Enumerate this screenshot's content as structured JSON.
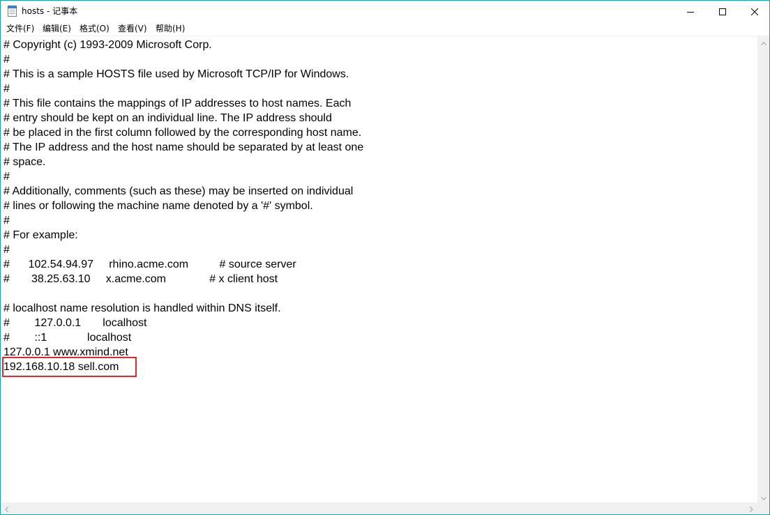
{
  "window": {
    "title": "hosts - 记事本",
    "app_icon": "notepad-icon",
    "controls": {
      "minimize": "minimize-icon",
      "maximize": "maximize-icon",
      "close": "close-icon"
    }
  },
  "menu": {
    "items": [
      {
        "label": "文件(F)"
      },
      {
        "label": "编辑(E)"
      },
      {
        "label": "格式(O)"
      },
      {
        "label": "查看(V)"
      },
      {
        "label": "帮助(H)"
      }
    ]
  },
  "document": {
    "lines": [
      "# Copyright (c) 1993-2009 Microsoft Corp.",
      "#",
      "# This is a sample HOSTS file used by Microsoft TCP/IP for Windows.",
      "#",
      "# This file contains the mappings of IP addresses to host names. Each",
      "# entry should be kept on an individual line. The IP address should",
      "# be placed in the first column followed by the corresponding host name.",
      "# The IP address and the host name should be separated by at least one",
      "# space.",
      "#",
      "# Additionally, comments (such as these) may be inserted on individual",
      "# lines or following the machine name denoted by a '#' symbol.",
      "#",
      "# For example:",
      "#",
      "#      102.54.94.97     rhino.acme.com          # source server",
      "#       38.25.63.10     x.acme.com              # x client host",
      "",
      "# localhost name resolution is handled within DNS itself.",
      "#\t127.0.0.1       localhost",
      "#\t::1             localhost",
      "127.0.0.1 www.xmind.net",
      "192.168.10.18 sell.com"
    ],
    "highlighted_line_index": 22,
    "highlight_color": "#e0282e"
  },
  "scrollbars": {
    "up": "chevron-up-icon",
    "down": "chevron-down-icon",
    "left": "chevron-left-icon",
    "right": "chevron-right-icon"
  }
}
